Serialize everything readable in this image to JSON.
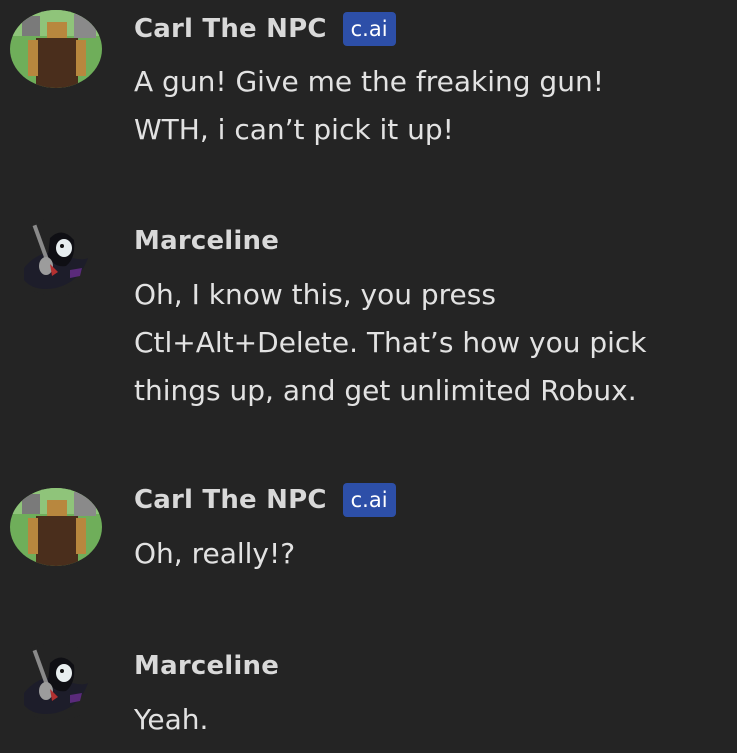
{
  "messages": [
    {
      "sender": "Carl The NPC",
      "badge": "c.ai",
      "avatar_icon": "roblox-npc-avatar",
      "text": "A gun! Give me the freaking gun!\nWTH, i can’t pick it up!"
    },
    {
      "sender": "Marceline",
      "avatar_icon": "marceline-avatar",
      "text": "Oh, I know this, you press\nCtl+Alt+Delete. That’s how you pick\nthings up, and get unlimited Robux."
    },
    {
      "sender": "Carl The NPC",
      "badge": "c.ai",
      "avatar_icon": "roblox-npc-avatar",
      "text": "Oh, really!?"
    },
    {
      "sender": "Marceline",
      "avatar_icon": "marceline-avatar",
      "text": "Yeah."
    }
  ],
  "colors": {
    "background": "#242424",
    "badge": "#2d4fa8",
    "name_text": "#d9d9d9",
    "body_text": "#e2e2e2"
  }
}
